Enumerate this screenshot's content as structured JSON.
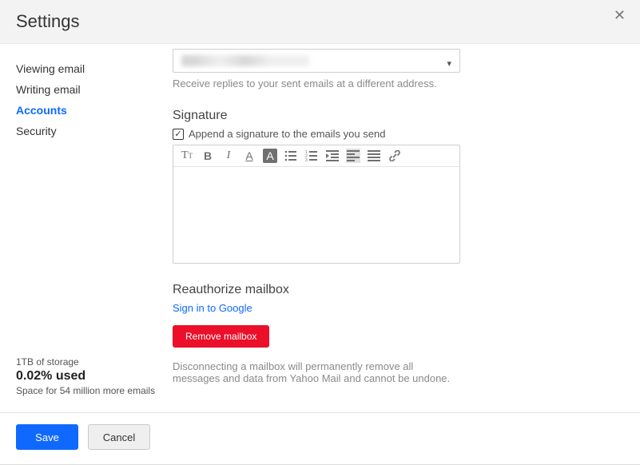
{
  "header": {
    "title": "Settings"
  },
  "sidebar": {
    "items": [
      {
        "label": "Viewing email",
        "active": false
      },
      {
        "label": "Writing email",
        "active": false
      },
      {
        "label": "Accounts",
        "active": true
      },
      {
        "label": "Security",
        "active": false
      }
    ],
    "storage": {
      "total_line": "1TB of storage",
      "used_line": "0.02% used",
      "remaining_line": "Space for 54 million more emails"
    }
  },
  "accounts_panel": {
    "reply_to": {
      "help": "Receive replies to your sent emails at a different address."
    },
    "signature": {
      "title": "Signature",
      "checkbox_label": "Append a signature to the emails you send",
      "checked": true,
      "body": ""
    },
    "reauthorize": {
      "title": "Reauthorize mailbox",
      "sign_in_label": "Sign in to Google",
      "remove_label": "Remove mailbox",
      "warning": "Disconnecting a mailbox will permanently remove all messages and data from Yahoo Mail and cannot be undone."
    }
  },
  "footer": {
    "save_label": "Save",
    "cancel_label": "Cancel"
  }
}
